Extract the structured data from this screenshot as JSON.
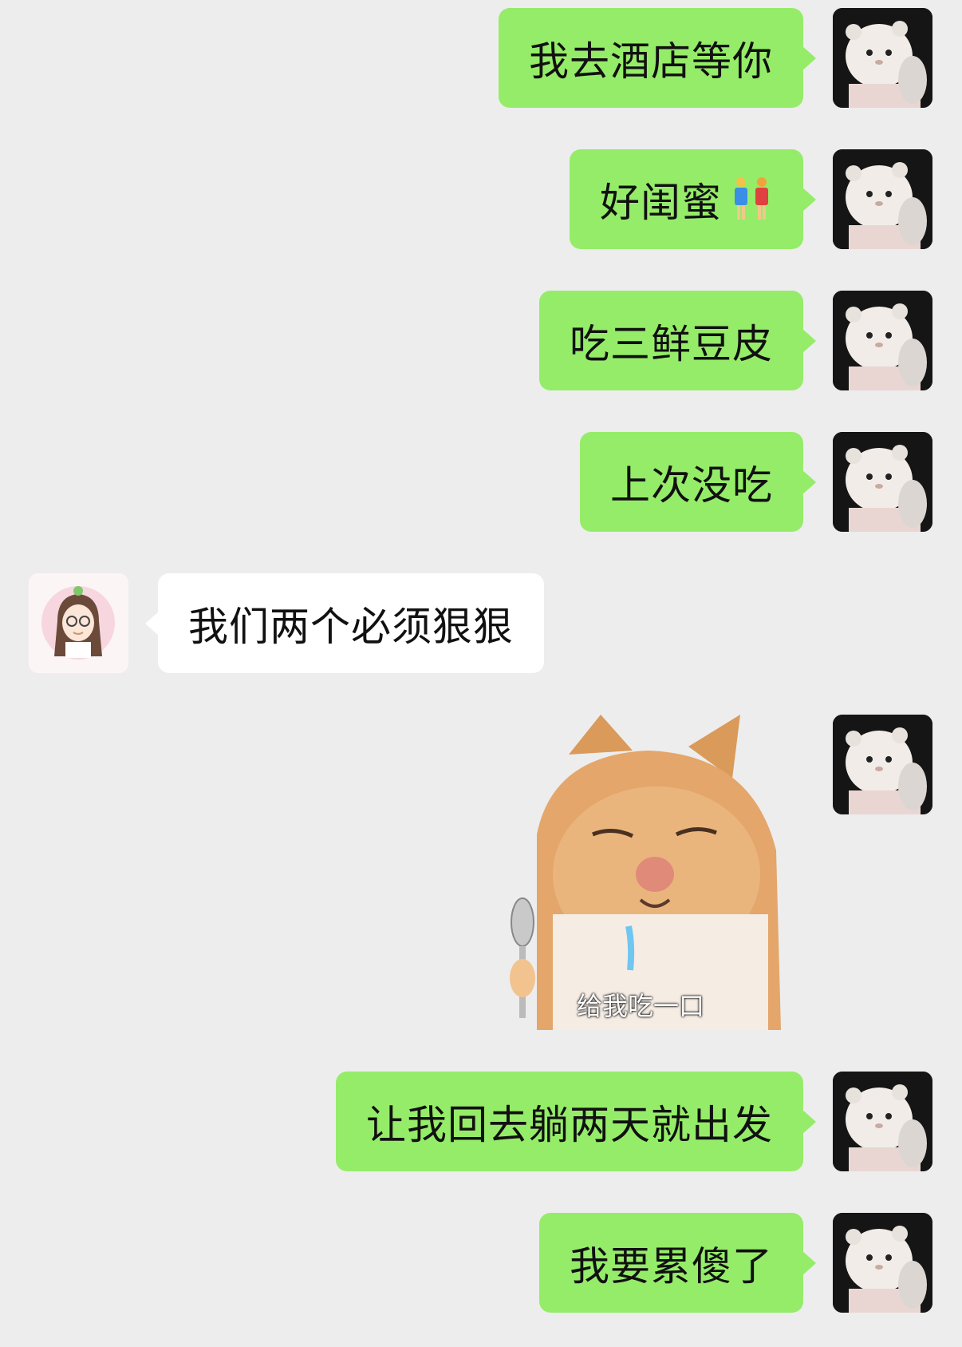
{
  "messages": [
    {
      "side": "me",
      "text": "我去酒店等你"
    },
    {
      "side": "me",
      "text": "好闺蜜",
      "emoji": "two-women-emoji"
    },
    {
      "side": "me",
      "text": "吃三鲜豆皮"
    },
    {
      "side": "me",
      "text": "上次没吃"
    },
    {
      "side": "other",
      "text": "我们两个必须狠狠"
    },
    {
      "side": "me",
      "sticker": "cat-drooling-spoon-sticker",
      "caption": "给我吃一口"
    },
    {
      "side": "me",
      "text": "让我回去躺两天就出发"
    },
    {
      "side": "me",
      "text": "我要累傻了"
    }
  ],
  "colors": {
    "background": "#ededed",
    "my_bubble": "#95ec69",
    "other_bubble": "#ffffff"
  }
}
